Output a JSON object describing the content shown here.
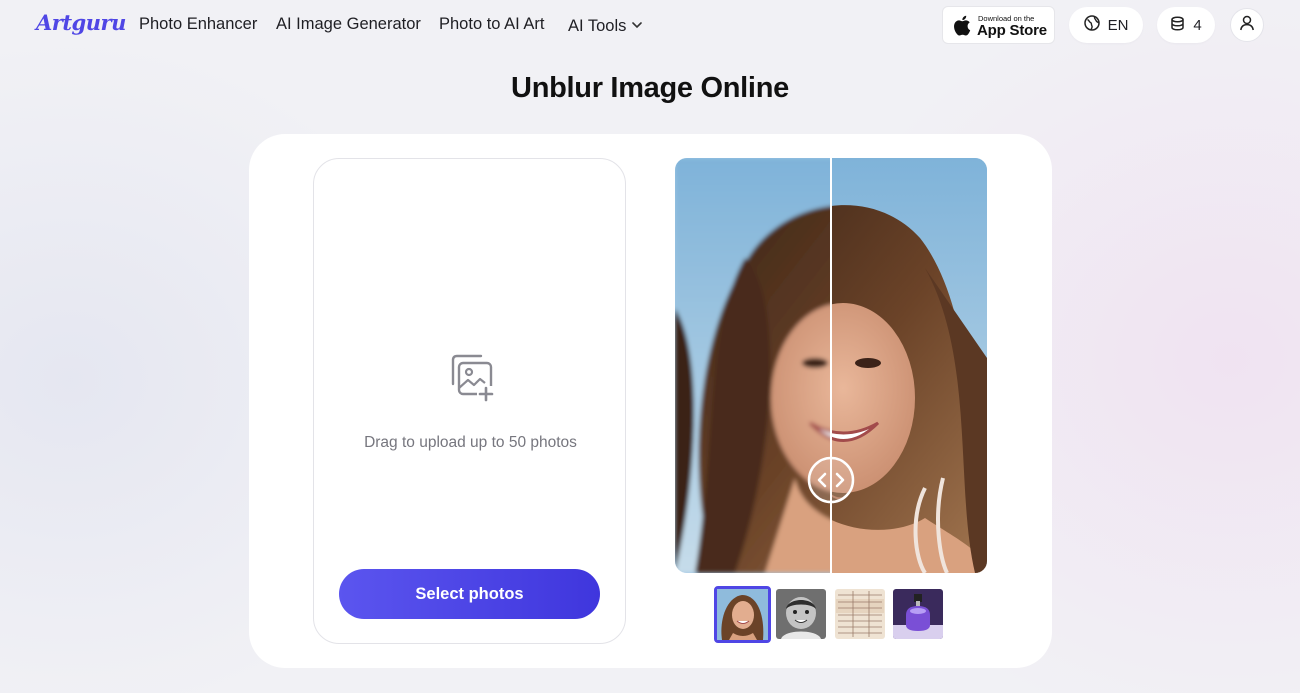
{
  "nav": {
    "logo": "Artguru",
    "links": [
      "Photo Enhancer",
      "AI Image Generator",
      "Photo to AI Art",
      "AI Tools"
    ],
    "app_store": {
      "small": "Download on the",
      "big": "App Store"
    },
    "language": "EN",
    "credits": "4"
  },
  "page": {
    "title": "Unblur Image Online"
  },
  "upload": {
    "hint": "Drag to upload up to 50 photos",
    "button": "Select photos"
  },
  "icons": [
    "apple-icon",
    "globe-icon",
    "coins-icon",
    "user-icon",
    "chevron-down-icon",
    "image-upload-icon",
    "compare-arrows-icon"
  ],
  "colors": {
    "brand": "#4f46e5",
    "button_start": "#5b55ef",
    "button_end": "#3f36dd",
    "background": "#f1f1f5"
  }
}
